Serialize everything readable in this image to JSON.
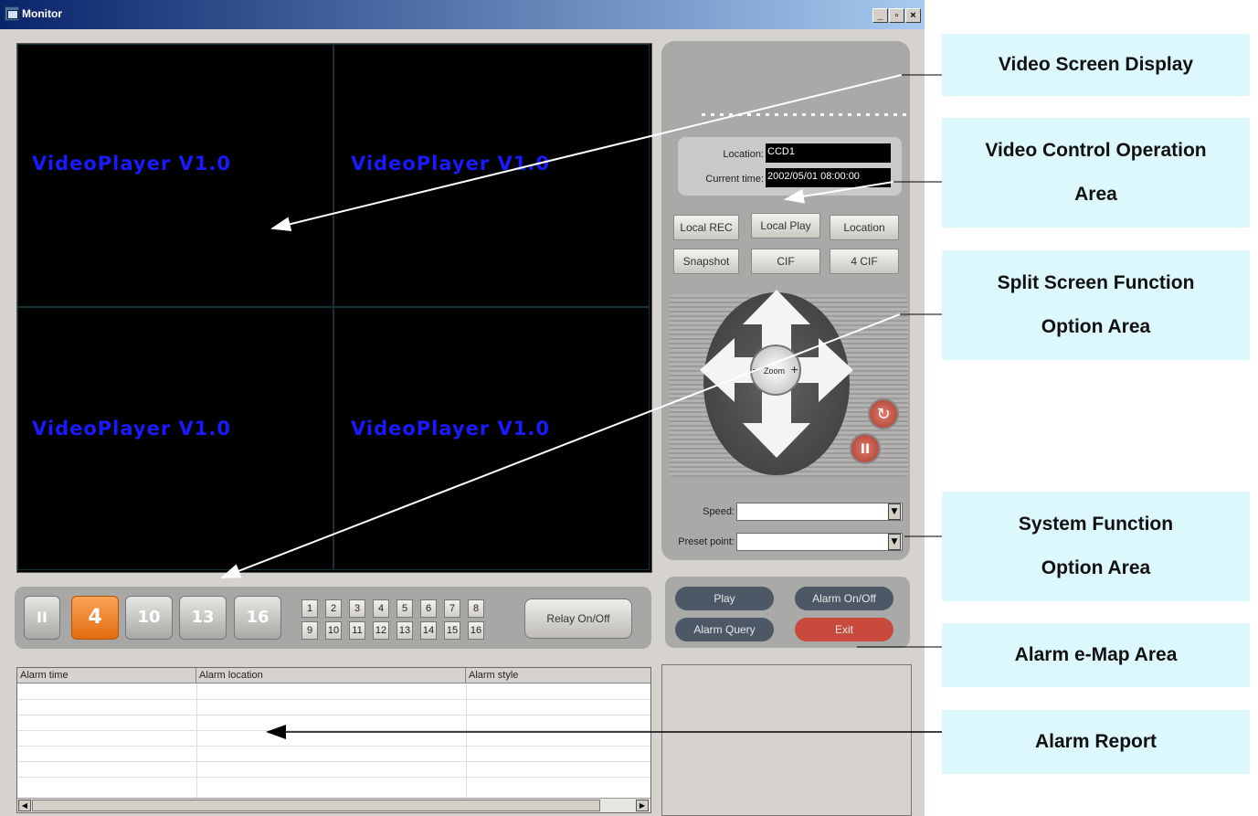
{
  "window": {
    "title": "Monitor",
    "buttons": [
      "_",
      "▫",
      "×"
    ]
  },
  "video": {
    "cells": [
      "VideoPlayer V1.0",
      "VideoPlayer V1.0",
      "VideoPlayer V1.0",
      "VideoPlayer V1.0"
    ]
  },
  "control": {
    "location_label": "Location:",
    "location_value": "CCD1",
    "time_label": "Current time:",
    "time_value": "2002/05/01 08:00:00",
    "buttons": [
      "Local REC",
      "Local Play",
      "Location",
      "Snapshot",
      "CIF",
      "4 CIF"
    ],
    "zoom_label": "Zoom",
    "zoom_minus": "−",
    "zoom_plus": "+",
    "speed_label": "Speed:",
    "preset_label": "Preset point:"
  },
  "split": {
    "pause_label": "II",
    "layouts": [
      "4",
      "10",
      "13",
      "16"
    ],
    "numbers": [
      "1",
      "2",
      "3",
      "4",
      "5",
      "6",
      "7",
      "8",
      "9",
      "10",
      "11",
      "12",
      "13",
      "14",
      "15",
      "16"
    ],
    "relay_label": "Relay On/Off"
  },
  "system": {
    "play": "Play",
    "alarm_onoff": "Alarm On/Off",
    "alarm_query": "Alarm Query",
    "exit": "Exit"
  },
  "alarm": {
    "columns": [
      "Alarm time",
      "Alarm location",
      "Alarm style"
    ]
  },
  "annotations": {
    "video_screen": "Video Screen Display",
    "video_control": "Video Control Operation Area",
    "split_screen": "Split Screen Function Option Area",
    "system_function": "System Function Option Area",
    "emap": "Alarm e-Map Area",
    "alarm_report": "Alarm Report"
  },
  "colors": {
    "video_text": "#1a1aff",
    "exit": "#c94a3c",
    "annotation_bg": "#ddf8fd"
  }
}
